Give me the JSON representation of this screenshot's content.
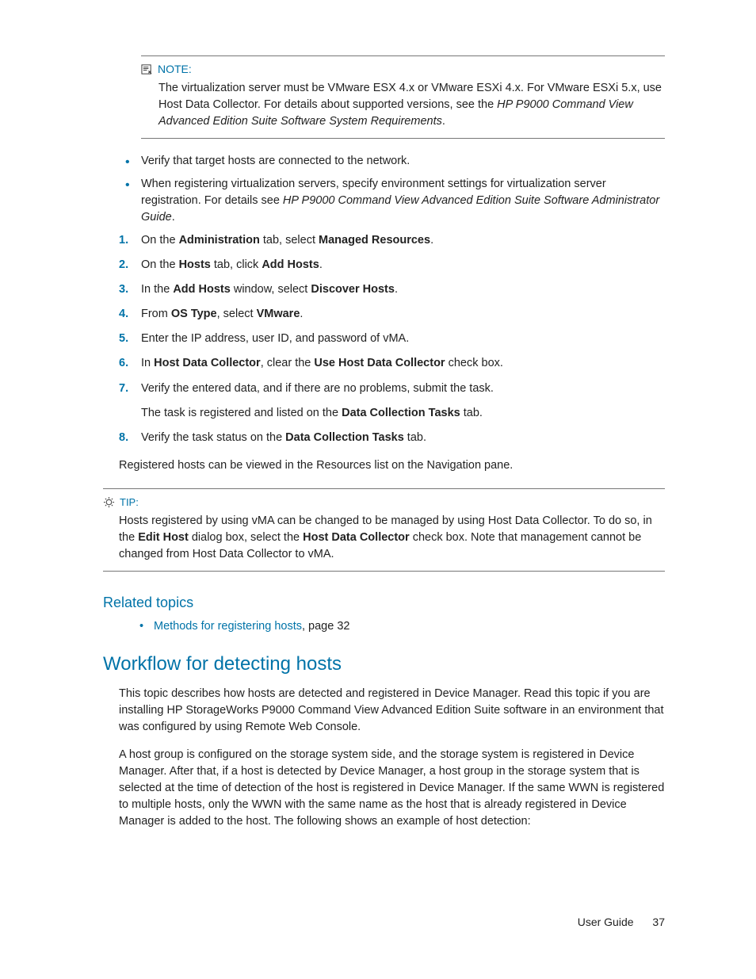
{
  "note": {
    "label": "NOTE:",
    "text_pre": "The virtualization server must be VMware ESX 4.x or VMware ESXi 4.x. For VMware ESXi 5.x, use Host Data Collector. For details about supported versions, see the ",
    "text_italic": "HP P9000 Command View Advanced Edition Suite Software System Requirements",
    "text_post": "."
  },
  "bullets": {
    "b1": "Verify that target hosts are connected to the network.",
    "b2_pre": "When registering virtualization servers, specify environment settings for virtualization server registration. For details see ",
    "b2_italic": "HP P9000 Command View Advanced Edition Suite Software Administrator Guide",
    "b2_post": "."
  },
  "steps": {
    "s1_a": "On the ",
    "s1_b": "Administration",
    "s1_c": " tab, select ",
    "s1_d": "Managed Resources",
    "s1_e": ".",
    "s2_a": "On the ",
    "s2_b": "Hosts",
    "s2_c": " tab, click ",
    "s2_d": "Add Hosts",
    "s2_e": ".",
    "s3_a": "In the ",
    "s3_b": "Add Hosts",
    "s3_c": " window, select ",
    "s3_d": "Discover Hosts",
    "s3_e": ".",
    "s4_a": "From ",
    "s4_b": "OS Type",
    "s4_c": ", select ",
    "s4_d": "VMware",
    "s4_e": ".",
    "s5": "Enter the IP address, user ID, and password of vMA.",
    "s6_a": "In ",
    "s6_b": "Host Data Collector",
    "s6_c": ", clear the ",
    "s6_d": "Use Host Data Collector",
    "s6_e": " check box.",
    "s7": "Verify the entered data, and if there are no problems, submit the task.",
    "s7_sub_a": "The task is registered and listed on the ",
    "s7_sub_b": "Data Collection Tasks",
    "s7_sub_c": " tab.",
    "s8_a": "Verify the task status on the ",
    "s8_b": "Data Collection Tasks",
    "s8_c": " tab."
  },
  "after_steps": "Registered hosts can be viewed in the Resources list on the Navigation pane.",
  "tip": {
    "label": "TIP:",
    "t_a": "Hosts registered by using vMA can be changed to be managed by using Host Data Collector. To do so, in the ",
    "t_b": "Edit Host",
    "t_c": " dialog box, select the ",
    "t_d": "Host Data Collector",
    "t_e": " check box. Note that management cannot be changed from Host Data Collector to vMA."
  },
  "related": {
    "heading": "Related topics",
    "link": "Methods for registering hosts",
    "suffix": ", page 32"
  },
  "section": {
    "heading": "Workflow for detecting hosts",
    "p1": "This topic describes how hosts are detected and registered in Device Manager. Read this topic if you are installing HP StorageWorks P9000 Command View Advanced Edition Suite software in an environment that was configured by using Remote Web Console.",
    "p2": "A host group is configured on the storage system side, and the storage system is registered in Device Manager. After that, if a host is detected by Device Manager, a host group in the storage system that is selected at the time of detection of the host is registered in Device Manager. If the same WWN is registered to multiple hosts, only the WWN with the same name as the host that is already registered in Device Manager is added to the host. The following shows an example of host detection:"
  },
  "footer": {
    "text": "User Guide",
    "page": "37"
  }
}
